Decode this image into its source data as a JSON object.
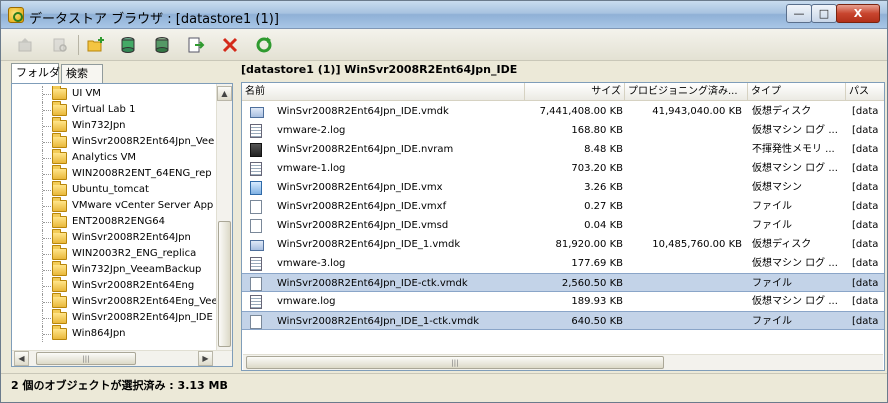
{
  "window": {
    "title": "データストア ブラウザ : [datastore1 (1)]",
    "controls": {
      "minimize": "—",
      "maximize": "□",
      "close": "X"
    }
  },
  "toolbar": {
    "buttons": [
      {
        "id": "nav-up",
        "icon": "folder-up-icon",
        "enabled": false
      },
      {
        "id": "browse",
        "icon": "browse-icon",
        "enabled": false
      },
      {
        "id": "new-folder",
        "icon": "new-folder-icon",
        "enabled": true
      },
      {
        "id": "upload",
        "icon": "upload-icon",
        "enabled": true
      },
      {
        "id": "download",
        "icon": "download-icon",
        "enabled": true
      },
      {
        "id": "register",
        "icon": "register-vm-icon",
        "enabled": true
      },
      {
        "id": "delete",
        "icon": "delete-icon",
        "enabled": true
      },
      {
        "id": "refresh",
        "icon": "refresh-icon",
        "enabled": true
      }
    ]
  },
  "left_pane": {
    "tabs": [
      {
        "label": "フォルダ",
        "active": true
      },
      {
        "label": "検索",
        "active": false
      }
    ],
    "tree": [
      "UI VM",
      "Virtual Lab 1",
      "Win732Jpn",
      "WinSvr2008R2Ent64Jpn_Vee",
      "Analytics VM",
      "WIN2008R2ENT_64ENG_rep",
      "Ubuntu_tomcat",
      "VMware vCenter Server App",
      "ENT2008R2ENG64",
      "WinSvr2008R2Ent64Jpn",
      "WIN2003R2_ENG_replica",
      "Win732Jpn_VeeamBackup",
      "WinSvr2008R2Ent64Eng",
      "WinSvr2008R2Ent64Eng_Vee",
      "WinSvr2008R2Ent64Jpn_IDE",
      "Win864Jpn"
    ],
    "selected_index": 14
  },
  "right_pane": {
    "path": "[datastore1 (1)] WinSvr2008R2Ent64Jpn_IDE",
    "columns": {
      "name": "名前",
      "size": "サイズ",
      "provisioned": "プロビジョニング済み...",
      "type": "タイプ",
      "path": "パス"
    },
    "files": [
      {
        "icon": "virtual-disk-icon",
        "name": "WinSvr2008R2Ent64Jpn_IDE.vmdk",
        "size": "7,441,408.00 KB",
        "provisioned": "41,943,040.00 KB",
        "type": "仮想ディスク",
        "path": "[data",
        "selected": false
      },
      {
        "icon": "log-file-icon",
        "name": "vmware-2.log",
        "size": "168.80 KB",
        "provisioned": "",
        "type": "仮想マシン ログ ...",
        "path": "[data",
        "selected": false
      },
      {
        "icon": "nvram-file-icon",
        "name": "WinSvr2008R2Ent64Jpn_IDE.nvram",
        "size": "8.48 KB",
        "provisioned": "",
        "type": "不揮発性メモリ ...",
        "path": "[data",
        "selected": false
      },
      {
        "icon": "log-file-icon",
        "name": "vmware-1.log",
        "size": "703.20 KB",
        "provisioned": "",
        "type": "仮想マシン ログ ...",
        "path": "[data",
        "selected": false
      },
      {
        "icon": "vm-config-icon",
        "name": "WinSvr2008R2Ent64Jpn_IDE.vmx",
        "size": "3.26 KB",
        "provisioned": "",
        "type": "仮想マシン",
        "path": "[data",
        "selected": false
      },
      {
        "icon": "file-icon",
        "name": "WinSvr2008R2Ent64Jpn_IDE.vmxf",
        "size": "0.27 KB",
        "provisioned": "",
        "type": "ファイル",
        "path": "[data",
        "selected": false
      },
      {
        "icon": "file-icon",
        "name": "WinSvr2008R2Ent64Jpn_IDE.vmsd",
        "size": "0.04 KB",
        "provisioned": "",
        "type": "ファイル",
        "path": "[data",
        "selected": false
      },
      {
        "icon": "virtual-disk-icon",
        "name": "WinSvr2008R2Ent64Jpn_IDE_1.vmdk",
        "size": "81,920.00 KB",
        "provisioned": "10,485,760.00 KB",
        "type": "仮想ディスク",
        "path": "[data",
        "selected": false
      },
      {
        "icon": "log-file-icon",
        "name": "vmware-3.log",
        "size": "177.69 KB",
        "provisioned": "",
        "type": "仮想マシン ログ ...",
        "path": "[data",
        "selected": false
      },
      {
        "icon": "file-icon",
        "name": "WinSvr2008R2Ent64Jpn_IDE-ctk.vmdk",
        "size": "2,560.50 KB",
        "provisioned": "",
        "type": "ファイル",
        "path": "[data",
        "selected": true
      },
      {
        "icon": "log-file-icon",
        "name": "vmware.log",
        "size": "189.93 KB",
        "provisioned": "",
        "type": "仮想マシン ログ ...",
        "path": "[data",
        "selected": false
      },
      {
        "icon": "file-icon",
        "name": "WinSvr2008R2Ent64Jpn_IDE_1-ctk.vmdk",
        "size": "640.50 KB",
        "provisioned": "",
        "type": "ファイル",
        "path": "[data",
        "selected": true
      }
    ]
  },
  "status_bar": {
    "text": "2 個のオブジェクトが選択済み : 3.13 MB"
  },
  "colors": {
    "selection": "#c3d3e8",
    "delete_red": "#d42a1a",
    "refresh_green": "#2f9a2f"
  }
}
